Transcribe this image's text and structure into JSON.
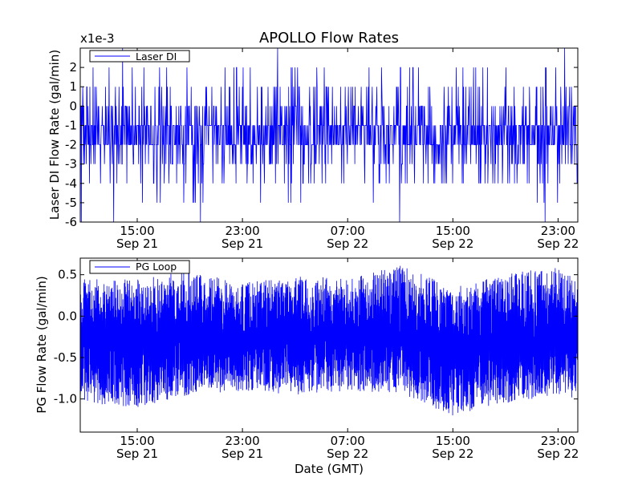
{
  "figure": {
    "title": "APOLLO Flow Rates",
    "xlabel": "Date (GMT)"
  },
  "colors": {
    "series": "#0000ff",
    "axes": "#000000",
    "background": "#ffffff"
  },
  "chart_data": [
    {
      "type": "line",
      "title": "APOLLO Flow Rates",
      "xlabel": "",
      "ylabel": "Laser DI Flow Rate (gal/min)",
      "offset_label": "x1e-3",
      "ylim": [
        -6,
        3
      ],
      "y_ticks": [
        -6,
        -5,
        -4,
        -3,
        -2,
        -1,
        0,
        1,
        2
      ],
      "y_tick_labels": [
        "-6",
        "-5",
        "-4",
        "-3",
        "-2",
        "-1",
        "0",
        "1",
        "2"
      ],
      "xlim": [
        "Sep 21 10:40",
        "Sep 23 00:30"
      ],
      "x_ticks": [
        "Sep 21 15:00",
        "Sep 21 23:00",
        "Sep 22 07:00",
        "Sep 22 15:00",
        "Sep 22 23:00"
      ],
      "x_tick_labels": [
        {
          "time": "15:00",
          "date": "Sep 21"
        },
        {
          "time": "23:00",
          "date": "Sep 21"
        },
        {
          "time": "07:00",
          "date": "Sep 22"
        },
        {
          "time": "15:00",
          "date": "Sep 22"
        },
        {
          "time": "23:00",
          "date": "Sep 22"
        }
      ],
      "legend": {
        "placement": "top-left",
        "entries": [
          "Laser DI"
        ]
      },
      "grid": false,
      "series": [
        {
          "name": "Laser DI",
          "units": "1e-3 gal/min",
          "note_values": "noisy quantized signal, mostly between -3 and 1, baseline about -1.5",
          "x": [
            "Sep 21 12:00",
            "Sep 21 16:00",
            "Sep 21 20:00",
            "Sep 22 00:00",
            "Sep 22 04:00",
            "Sep 22 08:00",
            "Sep 22 12:00",
            "Sep 22 16:00",
            "Sep 22 20:00",
            "Sep 23 00:00"
          ],
          "values": [
            -1.5,
            -1.5,
            -1.4,
            -1.5,
            -1.6,
            -1.5,
            -1.5,
            -1.4,
            -1.5,
            -1.5
          ],
          "min": -6,
          "max": 3
        }
      ]
    },
    {
      "type": "line",
      "title": "",
      "xlabel": "Date (GMT)",
      "ylabel": "PG Flow Rate (gal/min)",
      "ylim": [
        -1.4,
        0.7
      ],
      "y_ticks": [
        -1.0,
        -0.5,
        0.0,
        0.5
      ],
      "y_tick_labels": [
        "-1.0",
        "-0.5",
        "0.0",
        "0.5"
      ],
      "xlim": [
        "Sep 21 10:40",
        "Sep 23 00:30"
      ],
      "x_ticks": [
        "Sep 21 15:00",
        "Sep 21 23:00",
        "Sep 22 07:00",
        "Sep 22 15:00",
        "Sep 22 23:00"
      ],
      "x_tick_labels": [
        {
          "time": "15:00",
          "date": "Sep 21"
        },
        {
          "time": "23:00",
          "date": "Sep 21"
        },
        {
          "time": "07:00",
          "date": "Sep 22"
        },
        {
          "time": "15:00",
          "date": "Sep 22"
        },
        {
          "time": "23:00",
          "date": "Sep 22"
        }
      ],
      "legend": {
        "placement": "top-left",
        "entries": [
          "PG Loop"
        ]
      },
      "grid": false,
      "series": [
        {
          "name": "PG Loop",
          "x": [
            "Sep 21 11:00",
            "Sep 21 15:00",
            "Sep 21 19:00",
            "Sep 21 23:00",
            "Sep 22 03:00",
            "Sep 22 07:00",
            "Sep 22 11:00",
            "Sep 22 15:00",
            "Sep 22 19:00",
            "Sep 22 23:00",
            "Sep 23 00:30"
          ],
          "values_mean": [
            -0.3,
            -0.28,
            -0.25,
            -0.32,
            -0.22,
            -0.25,
            -0.3,
            -0.4,
            -0.32,
            -0.25,
            -0.28
          ],
          "values_upper": [
            0.45,
            0.45,
            0.55,
            0.4,
            0.5,
            0.45,
            0.62,
            0.35,
            0.5,
            0.62,
            0.4
          ],
          "values_lower": [
            -1.05,
            -1.1,
            -0.95,
            -0.9,
            -0.95,
            -0.9,
            -0.95,
            -1.2,
            -1.05,
            -0.95,
            -1.0
          ]
        }
      ]
    }
  ]
}
